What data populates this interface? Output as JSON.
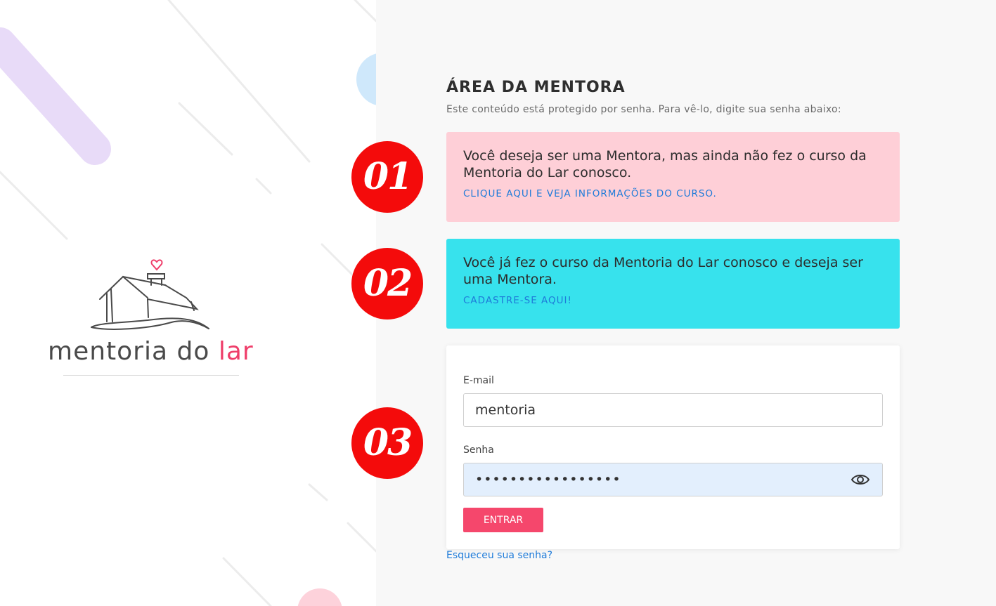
{
  "brand": {
    "logo_text_main": "mentoria do ",
    "logo_text_accent": "lar",
    "accent_color": "#ef3e6a"
  },
  "header": {
    "title": "ÁREA DA MENTORA",
    "subtitle": "Este conteúdo está protegido por senha. Para vê-lo, digite sua senha abaixo:"
  },
  "steps": [
    {
      "badge": "01",
      "text": "Você deseja ser uma Mentora, mas ainda não fez o curso da Mentoria do Lar conosco.",
      "link": "CLIQUE AQUI E VEJA INFORMAÇÕES DO CURSO.",
      "color": "#fecfd7"
    },
    {
      "badge": "02",
      "text": "Você já fez o curso da Mentoria do Lar conosco e deseja ser uma Mentora.",
      "link": "CADASTRE-SE AQUI!",
      "color": "#37e2ed"
    },
    {
      "badge": "03"
    }
  ],
  "form": {
    "email_label": "E-mail",
    "email_value": "mentoria",
    "password_label": "Senha",
    "password_value": "•••••••••••••••••",
    "submit_label": "ENTRAR",
    "show_password_icon": "eye-icon"
  },
  "forgot_password": "Esqueceu sua senha?",
  "colors": {
    "badge": "#f40b0b",
    "button": "#f5476c",
    "link": "#1e7bd9"
  }
}
